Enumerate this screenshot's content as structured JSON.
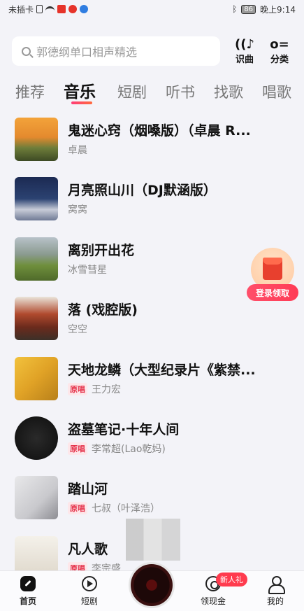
{
  "status_bar": {
    "carrier": "未插卡",
    "battery": "86",
    "time": "晚上9:14"
  },
  "search": {
    "placeholder": "郭德纲单口相声精选"
  },
  "top_actions": {
    "recognize_label": "识曲",
    "category_label": "分类"
  },
  "tabs": [
    "推荐",
    "音乐",
    "短剧",
    "听书",
    "找歌",
    "唱歌"
  ],
  "active_tab": "音乐",
  "songs": [
    {
      "title": "鬼迷心窍（烟嗓版）（卓晨 R...",
      "artist": "卓晨",
      "badge": ""
    },
    {
      "title": "月亮照山川（DJ默涵版）",
      "artist": "窝窝",
      "badge": ""
    },
    {
      "title": "离别开出花",
      "artist": "冰雪彗星",
      "badge": ""
    },
    {
      "title": "落 (戏腔版)",
      "artist": "空空",
      "badge": ""
    },
    {
      "title": "天地龙鳞（大型纪录片《紫禁...",
      "artist": "王力宏",
      "badge": "原唱"
    },
    {
      "title": "盗墓笔记·十年人间",
      "artist": "李常超(Lao乾妈)",
      "badge": "原唱"
    },
    {
      "title": "踏山河",
      "artist": "七叔（叶泽浩）",
      "badge": "原唱"
    },
    {
      "title": "凡人歌",
      "artist": "李宗盛",
      "badge": "原唱"
    }
  ],
  "reward": {
    "label": "登录领取"
  },
  "bottom_nav": {
    "home": "首页",
    "drama": "短剧",
    "cash": "领现金",
    "mine": "我的",
    "new_badge": "新人礼"
  },
  "colors": {
    "accent": "#ff3c78",
    "badge_text": "#e5334b",
    "background": "#f3f3f8"
  }
}
